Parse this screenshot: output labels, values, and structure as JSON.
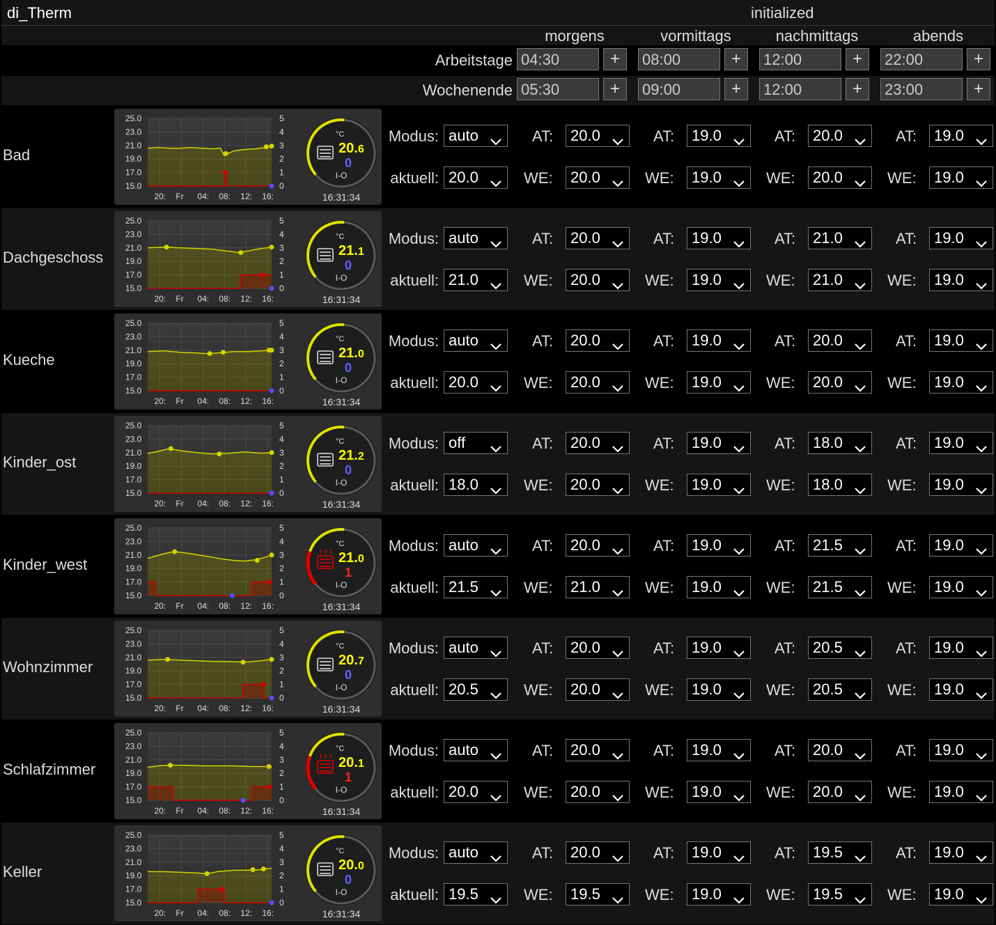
{
  "header": {
    "title": "di_Therm",
    "state": "initialized"
  },
  "periods": [
    "morgens",
    "vormittags",
    "nachmittags",
    "abends"
  ],
  "schedule": [
    {
      "label": "Arbeitstage",
      "times": [
        "04:30",
        "08:00",
        "12:00",
        "22:00"
      ],
      "plus": "+"
    },
    {
      "label": "Wochenende",
      "times": [
        "05:30",
        "09:00",
        "12:00",
        "23:00"
      ],
      "plus": "+"
    }
  ],
  "labels": {
    "modus": "Modus:",
    "aktuell": "aktuell:",
    "at": "AT:",
    "we": "WE:"
  },
  "chart_axes": {
    "y_left": [
      "25.0",
      "23.0",
      "21.0",
      "19.0",
      "17.0",
      "15.0"
    ],
    "y_right": [
      "5",
      "4",
      "3",
      "2",
      "1",
      "0"
    ],
    "x": [
      "20:",
      "Fr",
      "04:",
      "08:",
      "12:",
      "16:"
    ]
  },
  "gauge_labels": {
    "unit": "°C",
    "io": "I-O"
  },
  "colors": {
    "temp": "#d4d400",
    "heat": "#d40000",
    "valve": "#5050ff",
    "gauge_arc": "#e0e000",
    "gauge_heat": "#e00000",
    "row_a": "#000000",
    "row_b": "#151515"
  },
  "rooms": [
    {
      "name": "Bad",
      "modus": "auto",
      "aktuell": "20.0",
      "at": [
        "20.0",
        "19.0",
        "20.0",
        "19.0"
      ],
      "we": [
        "20.0",
        "19.0",
        "20.0",
        "19.0"
      ],
      "temp_int": "20.",
      "temp_dec": "6",
      "valve": "0",
      "time": "16:31:34",
      "heating": false,
      "icon": "radiator-off-icon",
      "chart_data": {
        "type": "line",
        "x_range_h": [
          18,
          17
        ],
        "temp_ylim": [
          15,
          25
        ],
        "temp": [
          [
            18,
            20.6
          ],
          [
            20,
            20.7
          ],
          [
            22,
            20.6
          ],
          [
            24,
            20.6
          ],
          [
            26,
            20.7
          ],
          [
            28,
            20.6
          ],
          [
            30,
            20.5
          ],
          [
            31.5,
            20.6
          ],
          [
            32.2,
            19.5
          ],
          [
            32.6,
            19.7
          ],
          [
            34,
            20.2
          ],
          [
            36,
            20.4
          ],
          [
            38,
            20.5
          ],
          [
            40,
            20.7
          ],
          [
            41,
            20.9
          ]
        ],
        "temp_points": [
          [
            32.5,
            19.8
          ],
          [
            40,
            20.8
          ],
          [
            41,
            20.9
          ]
        ],
        "heat": [
          [
            18,
            0
          ],
          [
            32.3,
            0
          ],
          [
            32.3,
            1
          ],
          [
            32.6,
            1
          ],
          [
            32.6,
            0
          ],
          [
            41,
            0
          ]
        ],
        "heat_points": [
          [
            32.4,
            1
          ]
        ],
        "valve_points": [
          [
            41,
            0
          ]
        ]
      }
    },
    {
      "name": "Dachgeschoss",
      "modus": "auto",
      "aktuell": "21.0",
      "at": [
        "20.0",
        "19.0",
        "21.0",
        "19.0"
      ],
      "we": [
        "20.0",
        "19.0",
        "21.0",
        "19.0"
      ],
      "temp_int": "21.",
      "temp_dec": "1",
      "valve": "0",
      "time": "16:31:34",
      "heating": false,
      "icon": "radiator-off-icon",
      "chart_data": {
        "type": "line",
        "x_range_h": [
          18,
          17
        ],
        "temp_ylim": [
          15,
          25
        ],
        "temp": [
          [
            18,
            21.0
          ],
          [
            21,
            21.1
          ],
          [
            24,
            21.0
          ],
          [
            27,
            20.9
          ],
          [
            30,
            20.8
          ],
          [
            33,
            20.5
          ],
          [
            35,
            20.3
          ],
          [
            37,
            20.6
          ],
          [
            39,
            20.9
          ],
          [
            41,
            21.1
          ]
        ],
        "temp_points": [
          [
            21.5,
            21.1
          ],
          [
            35.3,
            20.3
          ],
          [
            41,
            21.1
          ]
        ],
        "heat": [
          [
            18,
            0
          ],
          [
            35.2,
            0
          ],
          [
            35.2,
            1
          ],
          [
            41,
            1
          ]
        ],
        "heat_points": [
          [
            39.3,
            1
          ]
        ],
        "valve_points": [
          [
            41,
            0
          ]
        ]
      }
    },
    {
      "name": "Kueche",
      "modus": "auto",
      "aktuell": "20.0",
      "at": [
        "20.0",
        "19.0",
        "20.0",
        "19.0"
      ],
      "we": [
        "20.0",
        "19.0",
        "20.0",
        "19.0"
      ],
      "temp_int": "21.",
      "temp_dec": "0",
      "valve": "0",
      "time": "16:31:34",
      "heating": false,
      "icon": "radiator-off-icon",
      "chart_data": {
        "type": "line",
        "x_range_h": [
          18,
          17
        ],
        "temp_ylim": [
          15,
          25
        ],
        "temp": [
          [
            18,
            20.8
          ],
          [
            21,
            20.9
          ],
          [
            24,
            20.7
          ],
          [
            27,
            20.6
          ],
          [
            29,
            20.5
          ],
          [
            31,
            20.6
          ],
          [
            34,
            20.8
          ],
          [
            37,
            20.8
          ],
          [
            39,
            20.9
          ],
          [
            41,
            21.0
          ]
        ],
        "temp_points": [
          [
            29.5,
            20.5
          ],
          [
            32,
            20.7
          ],
          [
            40.5,
            21.0
          ],
          [
            41,
            21.0
          ]
        ],
        "heat": [
          [
            18,
            0
          ],
          [
            41,
            0
          ]
        ],
        "heat_points": [],
        "valve_points": [
          [
            41,
            0
          ]
        ]
      }
    },
    {
      "name": "Kinder_ost",
      "modus": "off",
      "aktuell": "18.0",
      "at": [
        "20.0",
        "19.0",
        "18.0",
        "19.0"
      ],
      "we": [
        "20.0",
        "19.0",
        "18.0",
        "19.0"
      ],
      "temp_int": "21.",
      "temp_dec": "2",
      "valve": "0",
      "time": "16:31:34",
      "heating": false,
      "icon": "radiator-off-icon",
      "chart_data": {
        "type": "line",
        "x_range_h": [
          18,
          17
        ],
        "temp_ylim": [
          15,
          25
        ],
        "temp": [
          [
            18,
            20.9
          ],
          [
            20,
            21.2
          ],
          [
            22,
            21.6
          ],
          [
            24,
            21.3
          ],
          [
            27,
            21.0
          ],
          [
            30,
            20.8
          ],
          [
            33,
            20.9
          ],
          [
            36,
            21.1
          ],
          [
            39,
            20.9
          ],
          [
            41,
            21.0
          ]
        ],
        "temp_points": [
          [
            22.3,
            21.6
          ],
          [
            31.3,
            20.8
          ],
          [
            41,
            21.0
          ]
        ],
        "heat": [
          [
            18,
            0
          ],
          [
            41,
            0
          ]
        ],
        "heat_points": [],
        "valve_points": [
          [
            41,
            0
          ]
        ]
      }
    },
    {
      "name": "Kinder_west",
      "modus": "auto",
      "aktuell": "21.5",
      "at": [
        "20.0",
        "19.0",
        "21.5",
        "19.0"
      ],
      "we": [
        "21.0",
        "19.0",
        "21.5",
        "19.0"
      ],
      "temp_int": "21.",
      "temp_dec": "0",
      "valve": "1",
      "time": "16:31:34",
      "heating": true,
      "icon": "radiator-on-icon",
      "chart_data": {
        "type": "line",
        "x_range_h": [
          18,
          17
        ],
        "temp_ylim": [
          15,
          25
        ],
        "temp": [
          [
            18,
            20.5
          ],
          [
            21,
            21.2
          ],
          [
            23,
            21.5
          ],
          [
            26,
            21.2
          ],
          [
            29,
            20.8
          ],
          [
            32,
            20.4
          ],
          [
            34,
            20.2
          ],
          [
            36,
            20.1
          ],
          [
            38,
            20.3
          ],
          [
            40,
            20.7
          ],
          [
            41,
            21.0
          ]
        ],
        "temp_points": [
          [
            23,
            21.5
          ],
          [
            38.3,
            20.2
          ],
          [
            41,
            21.0
          ]
        ],
        "heat": [
          [
            18,
            1
          ],
          [
            19.5,
            1
          ],
          [
            19.5,
            0
          ],
          [
            37.3,
            0
          ],
          [
            37.3,
            1
          ],
          [
            41,
            1
          ]
        ],
        "heat_points": [
          [
            40.5,
            1
          ]
        ],
        "valve_points": [
          [
            33.7,
            0
          ]
        ]
      }
    },
    {
      "name": "Wohnzimmer",
      "modus": "auto",
      "aktuell": "20.5",
      "at": [
        "20.0",
        "19.0",
        "20.5",
        "19.0"
      ],
      "we": [
        "20.0",
        "19.0",
        "20.5",
        "19.0"
      ],
      "temp_int": "20.",
      "temp_dec": "7",
      "valve": "0",
      "time": "16:31:34",
      "heating": false,
      "icon": "radiator-off-icon",
      "chart_data": {
        "type": "line",
        "x_range_h": [
          18,
          17
        ],
        "temp_ylim": [
          15,
          25
        ],
        "temp": [
          [
            18,
            20.6
          ],
          [
            21,
            20.7
          ],
          [
            24,
            20.6
          ],
          [
            27,
            20.5
          ],
          [
            30,
            20.4
          ],
          [
            33,
            20.4
          ],
          [
            36,
            20.3
          ],
          [
            39,
            20.5
          ],
          [
            41,
            20.7
          ]
        ],
        "temp_points": [
          [
            21.7,
            20.7
          ],
          [
            35.7,
            20.3
          ],
          [
            41,
            20.7
          ]
        ],
        "heat": [
          [
            18,
            0
          ],
          [
            35.7,
            0
          ],
          [
            35.7,
            1
          ],
          [
            39.5,
            1
          ],
          [
            39.5,
            0
          ],
          [
            41,
            0
          ]
        ],
        "heat_points": [
          [
            39.5,
            1
          ]
        ],
        "valve_points": [
          [
            41,
            0
          ]
        ]
      }
    },
    {
      "name": "Schlafzimmer",
      "modus": "auto",
      "aktuell": "20.0",
      "at": [
        "20.0",
        "19.0",
        "20.0",
        "19.0"
      ],
      "we": [
        "20.0",
        "19.0",
        "20.0",
        "19.0"
      ],
      "temp_int": "20.",
      "temp_dec": "1",
      "valve": "1",
      "time": "16:31:34",
      "heating": true,
      "icon": "radiator-on-icon",
      "chart_data": {
        "type": "line",
        "x_range_h": [
          18,
          17
        ],
        "temp_ylim": [
          15,
          25
        ],
        "temp": [
          [
            18,
            19.9
          ],
          [
            20,
            20.1
          ],
          [
            22,
            20.2
          ],
          [
            25,
            20.2
          ],
          [
            28,
            20.1
          ],
          [
            31,
            20.1
          ],
          [
            34,
            20.1
          ],
          [
            37,
            20.0
          ],
          [
            41,
            20.0
          ]
        ],
        "temp_points": [
          [
            22.2,
            20.2
          ],
          [
            40.5,
            20.0
          ]
        ],
        "heat": [
          [
            18,
            1
          ],
          [
            22.7,
            1
          ],
          [
            22.7,
            0
          ],
          [
            37.3,
            0
          ],
          [
            37.3,
            1
          ],
          [
            41,
            1
          ]
        ],
        "heat_points": [
          [
            40.5,
            1
          ]
        ],
        "valve_points": [
          [
            35.7,
            0
          ]
        ]
      }
    },
    {
      "name": "Keller",
      "modus": "auto",
      "aktuell": "19.5",
      "at": [
        "20.0",
        "19.0",
        "19.5",
        "19.0"
      ],
      "we": [
        "19.5",
        "19.0",
        "19.5",
        "19.0"
      ],
      "temp_int": "20.",
      "temp_dec": "0",
      "valve": "0",
      "time": "16:31:34",
      "heating": false,
      "icon": "radiator-off-icon",
      "chart_data": {
        "type": "line",
        "x_range_h": [
          18,
          17
        ],
        "temp_ylim": [
          15,
          25
        ],
        "temp": [
          [
            18,
            19.6
          ],
          [
            21,
            19.6
          ],
          [
            24,
            19.5
          ],
          [
            27,
            19.4
          ],
          [
            29,
            19.3
          ],
          [
            31,
            19.6
          ],
          [
            34,
            19.8
          ],
          [
            37,
            19.8
          ],
          [
            39,
            19.9
          ],
          [
            41,
            20.1
          ]
        ],
        "temp_points": [
          [
            29,
            19.3
          ],
          [
            37.5,
            19.9
          ],
          [
            39.5,
            20.0
          ]
        ],
        "heat": [
          [
            18,
            0
          ],
          [
            27.3,
            0
          ],
          [
            27.3,
            1
          ],
          [
            32.2,
            1
          ],
          [
            32.2,
            0
          ],
          [
            41,
            0
          ]
        ],
        "heat_points": [
          [
            31.7,
            1
          ]
        ],
        "valve_points": [
          [
            41,
            0
          ]
        ]
      }
    }
  ]
}
